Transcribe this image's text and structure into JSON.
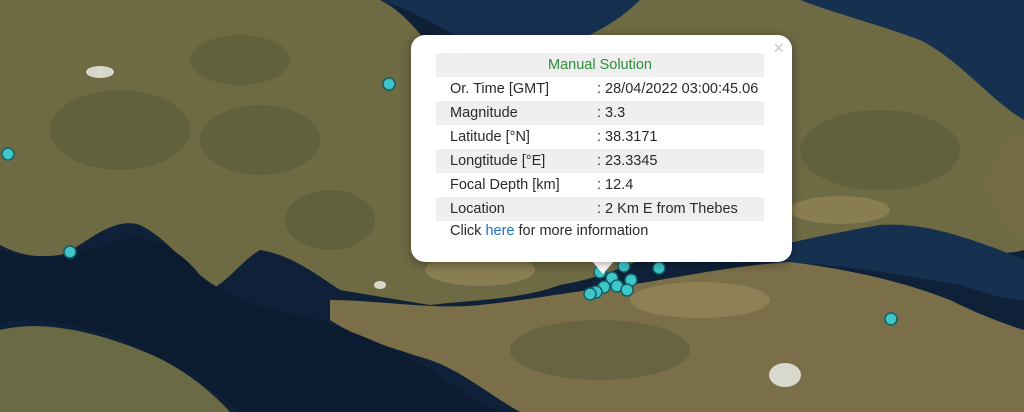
{
  "popup": {
    "title": "Manual Solution",
    "close_glyph": "×",
    "rows": [
      {
        "label": "Or. Time [GMT]",
        "value": ": 28/04/2022 03:00:45.06"
      },
      {
        "label": "Magnitude",
        "value": ": 3.3"
      },
      {
        "label": "Latitude [°N]",
        "value": ": 38.3171"
      },
      {
        "label": "Longtitude [°E]",
        "value": ": 23.3345"
      },
      {
        "label": "Focal Depth [km]",
        "value": ": 12.4"
      },
      {
        "label": "Location",
        "value": ": 2 Km E from Thebes"
      }
    ],
    "more": {
      "prefix": "Click ",
      "link": "here",
      "suffix": " for more information"
    }
  },
  "colors": {
    "marker_fill": "#3fc6c8",
    "marker_stroke": "#135f66",
    "title_text": "#2f8b3a",
    "link": "#1a6fc0"
  },
  "icons": {
    "close": "close-icon",
    "marker": "earthquake-marker"
  }
}
